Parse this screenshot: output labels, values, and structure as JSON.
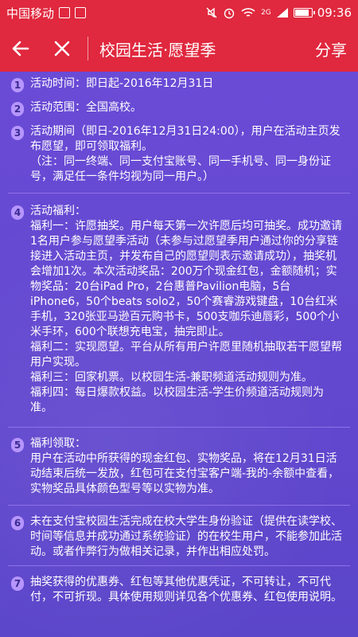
{
  "statusbar": {
    "carrier": "中国移动",
    "network": "2G",
    "time": "09:36",
    "battery_level": 0.9
  },
  "navbar": {
    "back_icon": "back-arrow-icon",
    "close_icon": "close-icon",
    "title": "校园生活·愿望季",
    "share_label": "分享"
  },
  "items": [
    {
      "number": "1",
      "text": "活动时间：即日起-2016年12月31日"
    },
    {
      "number": "2",
      "text": "活动范围：全国高校。"
    },
    {
      "number": "3",
      "text": "活动期间（即日-2016年12月31日24:00），用户在活动主页发布愿望，即可领取福利。\n（注：同一终端、同一支付宝账号、同一手机号、同一身份证号，满足任一条件均视为同一用户。）"
    },
    {
      "number": "4",
      "text": "活动福利：\n福利一：许愿抽奖。用户每天第一次许愿后均可抽奖。成功邀请1名用户参与愿望季活动（未参与过愿望季用户通过你的分享链接进入活动主页，并发布自己的愿望则表示邀请成功），抽奖机会增加1次。本次活动奖品：200万个现金红包，金额随机；实物奖品：20台iPad Pro，2台惠普Pavilion电脑，5台iPhone6，50个beats solo2，50个赛睿游戏键盘，10台红米手机，320张亚马逊百元购书卡，500支咖乐迪唇彩，500个小米手环，600个联想充电宝，抽完即止。\n福利二：实现愿望。平台从所有用户许愿里随机抽取若干愿望帮用户实现。\n福利三：回家机票。以校园生活-兼职频道活动规则为准。\n福利四：每日爆款权益。以校园生活-学生价频道活动规则为准。"
    },
    {
      "number": "5",
      "text": "福利领取：\n用户在活动中所获得的现金红包、实物奖品，将在12月31日活动结束后统一发放，红包可在支付宝客户端-我的-余额中查看，实物奖品具体颜色型号等以实物为准。"
    },
    {
      "number": "6",
      "text": "未在支付宝校园生活完成在校大学生身份验证（提供在读学校、时间等信息并成功通过系统验证）的在校生用户，不能参加此活动。或者作弊行为做相关记录，并作出相应处罚。"
    },
    {
      "number": "7",
      "text": "抽奖获得的优惠券、红包等其他优惠凭证，不可转让，不可代付，不可折现。具体使用规则详见各个优惠券、红包使用说明。"
    }
  ]
}
